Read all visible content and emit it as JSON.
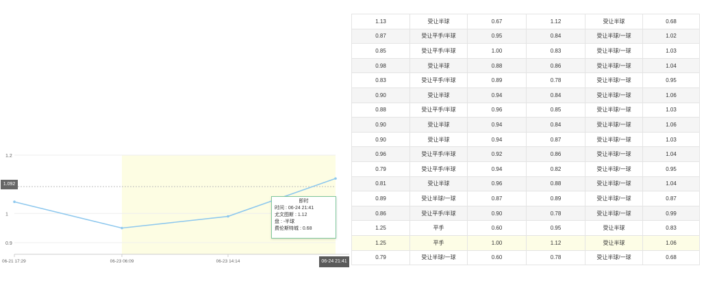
{
  "chart_data": {
    "type": "line",
    "x": [
      "06-21 17:29",
      "06-23 06:09",
      "06-23 14:14",
      "06-24 21:41"
    ],
    "values": [
      1.04,
      0.95,
      0.99,
      1.12
    ],
    "yticks": [
      "1.2",
      "1",
      "0.9"
    ],
    "yticks_values": [
      1.2,
      1.0,
      0.9
    ],
    "ylim": [
      0.86,
      1.2
    ],
    "reference_value": 1.092,
    "reference_label": "1.092",
    "x_highlight_label": "06-24 21:41",
    "grid": true,
    "colors": {
      "line": "#8ec8ee",
      "shade": "#fdfde3",
      "grid": "#eeeeee",
      "ref": "#bbbbbb"
    }
  },
  "tooltip": {
    "title": "即时",
    "time": "时间 : 06-24 21:41",
    "line2": "尤文图斯 : 1.12",
    "line3": "盘 : -半球",
    "line4": "费伦斯特城 : 0.68"
  },
  "table": {
    "rows": [
      [
        "1.13",
        "受让半球",
        "0.67",
        "1.12",
        "受让半球",
        "0.68"
      ],
      [
        "0.87",
        "受让平手/半球",
        "0.95",
        "0.84",
        "受让半球/一球",
        "1.02"
      ],
      [
        "0.85",
        "受让平手/半球",
        "1.00",
        "0.83",
        "受让半球/一球",
        "1.03"
      ],
      [
        "0.98",
        "受让半球",
        "0.88",
        "0.86",
        "受让半球/一球",
        "1.04"
      ],
      [
        "0.83",
        "受让平手/半球",
        "0.89",
        "0.78",
        "受让半球/一球",
        "0.95"
      ],
      [
        "0.90",
        "受让半球",
        "0.94",
        "0.84",
        "受让半球/一球",
        "1.06"
      ],
      [
        "0.88",
        "受让平手/半球",
        "0.96",
        "0.85",
        "受让半球/一球",
        "1.03"
      ],
      [
        "0.90",
        "受让半球",
        "0.94",
        "0.84",
        "受让半球/一球",
        "1.06"
      ],
      [
        "0.90",
        "受让半球",
        "0.94",
        "0.87",
        "受让半球/一球",
        "1.03"
      ],
      [
        "0.96",
        "受让平手/半球",
        "0.92",
        "0.86",
        "受让半球/一球",
        "1.04"
      ],
      [
        "0.79",
        "受让平手/半球",
        "0.94",
        "0.82",
        "受让半球/一球",
        "0.95"
      ],
      [
        "0.81",
        "受让半球",
        "0.96",
        "0.88",
        "受让半球/一球",
        "1.04"
      ],
      [
        "0.89",
        "受让半球/一球",
        "0.87",
        "0.89",
        "受让半球/一球",
        "0.87"
      ],
      [
        "0.86",
        "受让平手/半球",
        "0.90",
        "0.78",
        "受让半球/一球",
        "0.99"
      ],
      [
        "1.25",
        "平手",
        "0.60",
        "0.95",
        "受让半球",
        "0.83"
      ],
      [
        "1.25",
        "平手",
        "1.00",
        "1.12",
        "受让半球",
        "1.06"
      ],
      [
        "0.79",
        "受让半球/一球",
        "0.60",
        "0.78",
        "受让半球/一球",
        "0.68"
      ]
    ],
    "highlight_row": 15
  }
}
